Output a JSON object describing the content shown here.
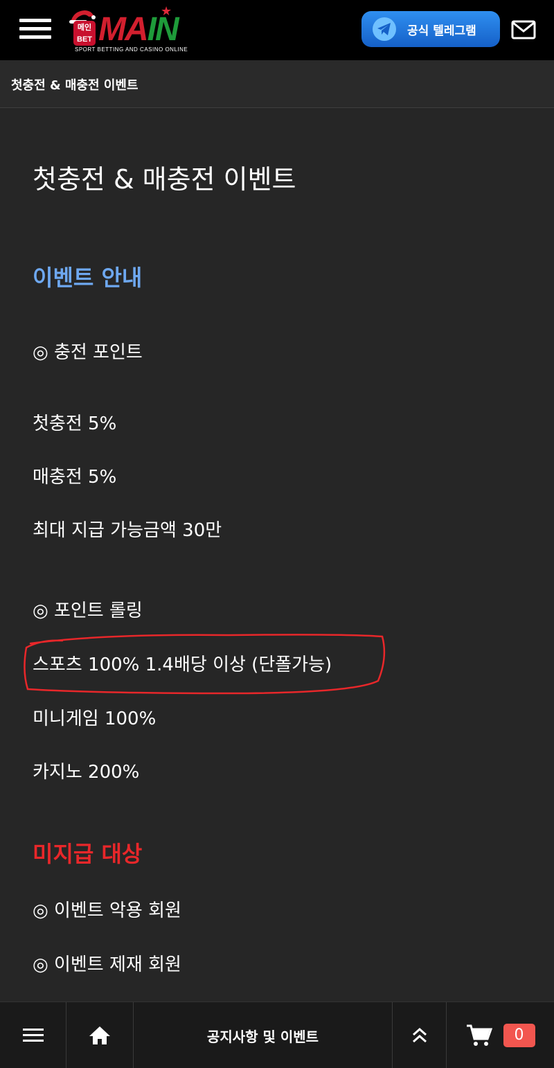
{
  "header": {
    "logo_badge_line1": "메인",
    "logo_badge_line2": "BET",
    "logo_word_a": "MA",
    "logo_word_b": "IN",
    "logo_tagline": "SPORT BETTING AND CASINO ONLINE",
    "telegram_label": "공식 텔레그램",
    "icons": {
      "menu": "hamburger-icon",
      "telegram": "telegram-icon",
      "mail": "mail-icon"
    },
    "colors": {
      "telegram_button": "#1f73dc",
      "logo_red": "#d21f2e",
      "logo_green": "#1e9b3a"
    }
  },
  "breadcrumb": "첫충전 & 매충전 이벤트",
  "post": {
    "title": "첫충전 & 매충전 이벤트",
    "section_info": "이벤트 안내",
    "charge_point_heading": "◎ 충전 포인트",
    "charge_lines": [
      "첫충전 5%",
      "매충전 5%",
      "최대 지급 가능금액 30만"
    ],
    "rolling_heading": "◎ 포인트 롤링",
    "rolling_lines": [
      "스포츠 100% 1.4배당 이상 (단폴가능)",
      "미니게임 100%",
      "카지노 200%"
    ],
    "section_excluded": "미지급 대상",
    "excluded_lines": [
      "◎ 이벤트 악용 회원",
      "◎ 이벤트 제재 회원"
    ],
    "colors": {
      "section_info": "#6ea8f0",
      "section_excluded": "#e8272a",
      "highlight_ring": "#e8272a"
    }
  },
  "bottom_nav": {
    "title": "공지사항 및 이벤트",
    "cart_count": "0",
    "icons": {
      "menu": "hamburger-icon",
      "home": "home-icon",
      "top": "double-chevron-up-icon",
      "cart": "cart-icon"
    },
    "colors": {
      "cart_badge": "#f2564f"
    }
  }
}
